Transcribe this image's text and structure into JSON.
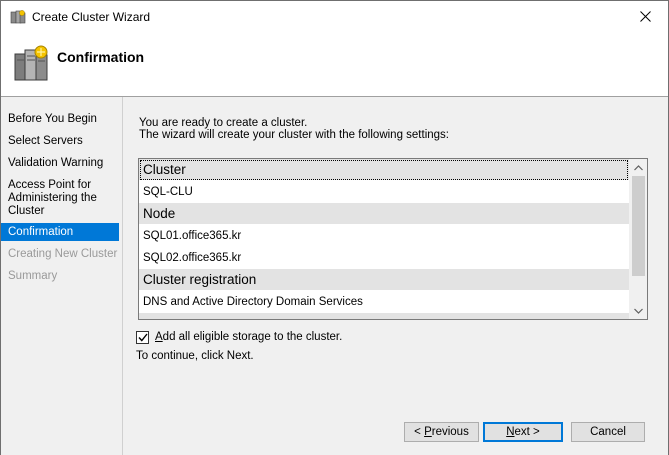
{
  "window": {
    "title": "Create Cluster Wizard"
  },
  "header": {
    "page_title": "Confirmation"
  },
  "nav": {
    "items": [
      {
        "label": "Before You Begin",
        "state": "normal"
      },
      {
        "label": "Select Servers",
        "state": "normal"
      },
      {
        "label": "Validation Warning",
        "state": "normal"
      },
      {
        "label": "Access Point for Administering the Cluster",
        "state": "normal"
      },
      {
        "label": "Confirmation",
        "state": "active"
      },
      {
        "label": "Creating New Cluster",
        "state": "disabled"
      },
      {
        "label": "Summary",
        "state": "disabled"
      }
    ]
  },
  "main": {
    "intro_line1": "You are ready to create a cluster.",
    "intro_line2": "The wizard will create your cluster with the following settings:",
    "settings": [
      {
        "type": "group",
        "text": "Cluster"
      },
      {
        "type": "item",
        "text": "SQL-CLU"
      },
      {
        "type": "group",
        "text": "Node"
      },
      {
        "type": "item",
        "text": "SQL01.office365.kr"
      },
      {
        "type": "item",
        "text": "SQL02.office365.kr"
      },
      {
        "type": "group",
        "text": "Cluster registration"
      },
      {
        "type": "item",
        "text": "DNS and Active Directory Domain Services"
      }
    ],
    "storage_checkbox": {
      "mnemonic": "A",
      "label_rest": "dd all eligible storage to the cluster.",
      "checked": true
    },
    "continue_text": "To continue, click Next."
  },
  "footer": {
    "previous": {
      "prefix": "< ",
      "mnemonic": "P",
      "rest": "revious"
    },
    "next": {
      "mnemonic": "N",
      "rest": "ext >"
    },
    "cancel_label": "Cancel"
  },
  "colors": {
    "accent": "#0078d7",
    "panel_bg": "#f0f0f0",
    "group_row_bg": "#e3e3e3",
    "disabled_text": "#9a9a9a"
  },
  "icons": {
    "title": "cluster-app-icon",
    "header": "cluster-servers-icon",
    "close": "close-icon",
    "scroll_up": "chevron-up-icon",
    "scroll_down": "chevron-down-icon",
    "check": "checkmark-icon"
  }
}
